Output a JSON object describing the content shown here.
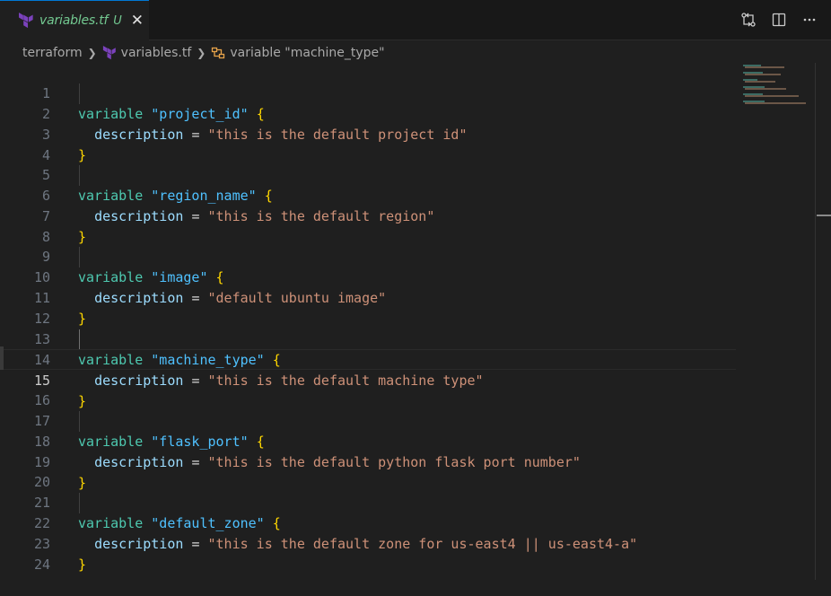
{
  "tab": {
    "title": "variables.tf",
    "modified": "U",
    "close": "✕"
  },
  "breadcrumb": {
    "folder": "terraform",
    "file": "variables.tf",
    "symbol": "variable \"machine_type\""
  },
  "editor": {
    "active_line": 15,
    "lines": [
      {
        "n": "1"
      },
      {
        "n": "2"
      },
      {
        "n": "3"
      },
      {
        "n": "4"
      },
      {
        "n": "5"
      },
      {
        "n": "6"
      },
      {
        "n": "7"
      },
      {
        "n": "8"
      },
      {
        "n": "9"
      },
      {
        "n": "10"
      },
      {
        "n": "11"
      },
      {
        "n": "12"
      },
      {
        "n": "13"
      },
      {
        "n": "14"
      },
      {
        "n": "15"
      },
      {
        "n": "16"
      },
      {
        "n": "17"
      },
      {
        "n": "18"
      },
      {
        "n": "19"
      },
      {
        "n": "20"
      },
      {
        "n": "21"
      },
      {
        "n": "22"
      },
      {
        "n": "23"
      },
      {
        "n": "24"
      }
    ],
    "code": {
      "kw_variable": "variable",
      "attr_description": "description",
      "eq": "=",
      "open": "{",
      "close": "}",
      "var1": {
        "name": "\"project_id\"",
        "desc": "\"this is the default project id\""
      },
      "var2": {
        "name": "\"region_name\"",
        "desc": "\"this is the default region\""
      },
      "var3": {
        "name": "\"image\"",
        "desc": "\"default ubuntu image\""
      },
      "var4": {
        "name": "\"machine_type\"",
        "desc": "\"this is the default machine type\""
      },
      "var5": {
        "name": "\"flask_port\"",
        "desc": "\"this is the default python flask port number\""
      },
      "var6": {
        "name": "\"default_zone\"",
        "desc": "\"this is the default zone for us-east4 || us-east4-a\""
      }
    }
  },
  "colors": {
    "keyword": "#4ec9b0",
    "string": "#ce9178",
    "name": "#4fc1ff",
    "bracket": "#ffd700",
    "attribute": "#9cdcfe",
    "terraform": "#7b42bc",
    "modified": "#73c991"
  },
  "icons": {
    "tab": "terraform-icon",
    "actions": [
      "compare-changes-icon",
      "split-editor-icon",
      "more-actions-icon"
    ],
    "breadcrumb_file": "terraform-icon",
    "breadcrumb_symbol": "variable-symbol-icon"
  }
}
